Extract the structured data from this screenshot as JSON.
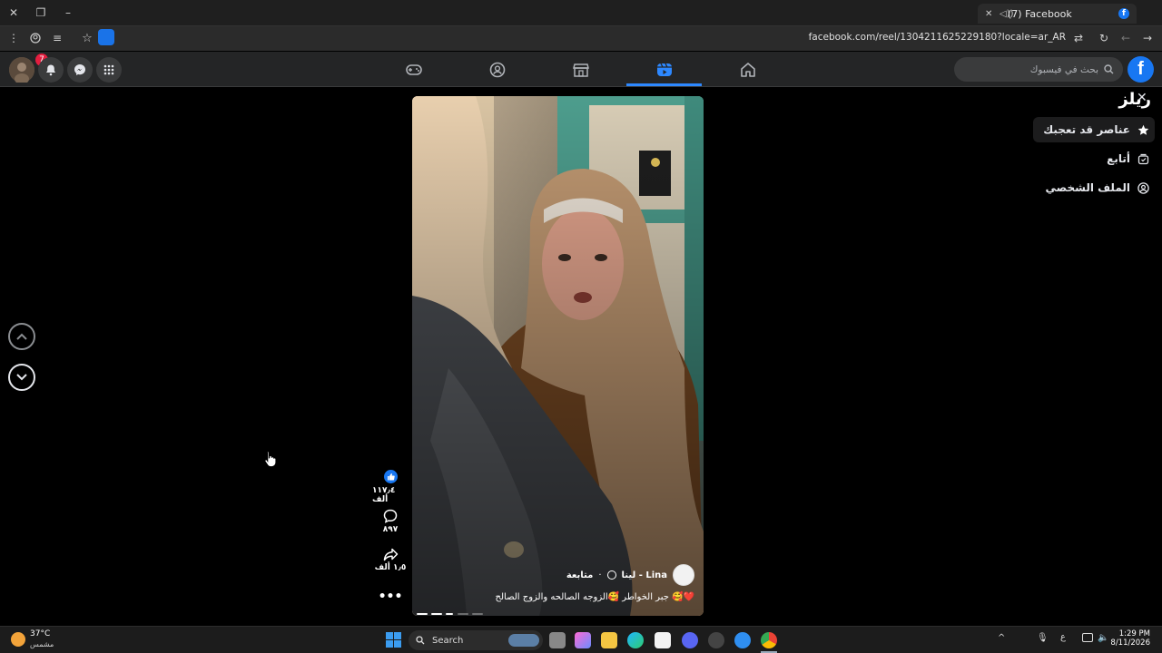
{
  "browser": {
    "tab_title": "(7) Facebook",
    "url": "facebook.com/reel/1304211625229180?locale=ar_AR"
  },
  "header": {
    "search_placeholder": "بحث في فيسبوك",
    "notifications_count": "7",
    "active_nav": "reels"
  },
  "sidebar": {
    "title": "ريلز",
    "items": [
      {
        "label": "عناصر قد تعجبك",
        "icon": "star-icon"
      },
      {
        "label": "أتابع",
        "icon": "following-icon"
      },
      {
        "label": "الملف الشخصي",
        "icon": "profile-icon"
      }
    ]
  },
  "reel": {
    "author": "لينا - Lina",
    "follow_label": "متابعة",
    "caption": "جبر الخواطر 🥰الزوجه الصالحه والزوج الصالح 🥰❤️"
  },
  "actions": {
    "likes": "١١٧٫٤ ألف",
    "comments": "٨٩٧",
    "shares": "١٫٥ ألف"
  },
  "taskbar": {
    "temperature": "37°C",
    "weather_label": "مشمس",
    "search_label": "Search",
    "clock_time": "1:29 PM",
    "clock_date": "8/11/2026",
    "lang": "ع"
  }
}
